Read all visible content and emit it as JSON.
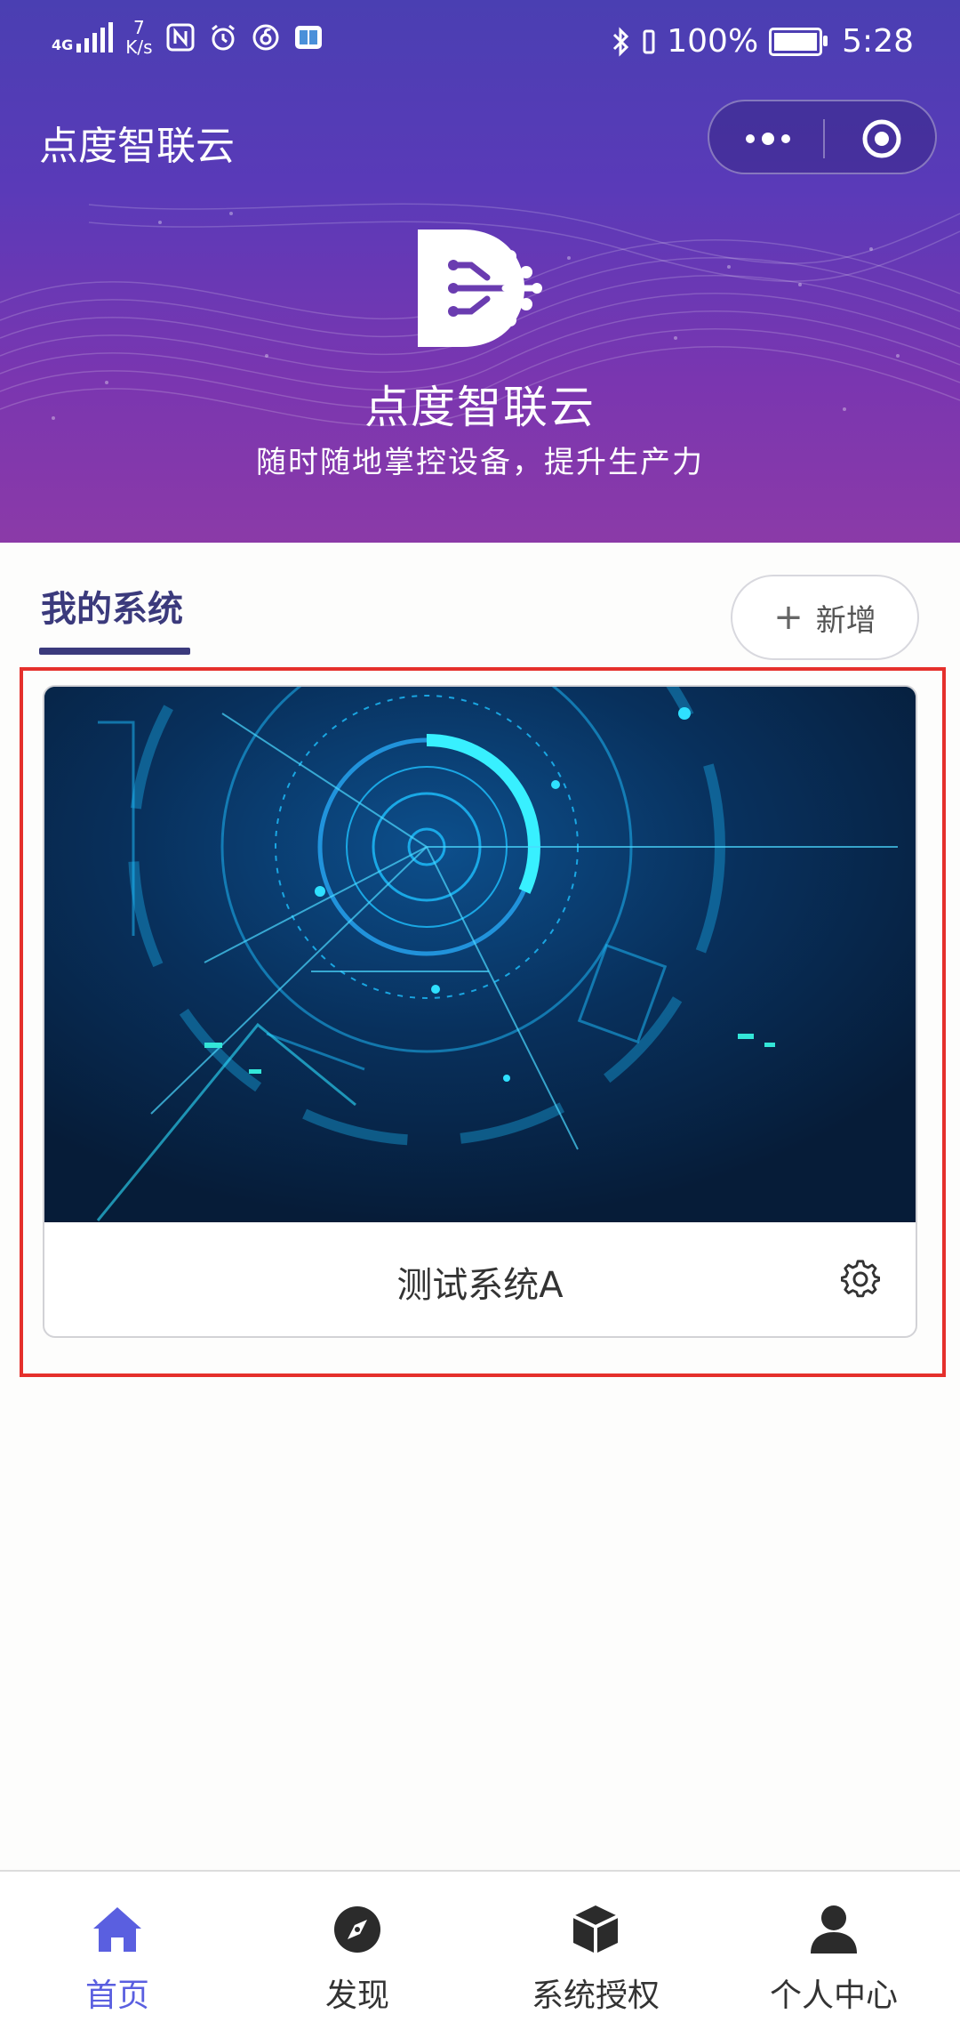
{
  "status_bar": {
    "network": "4G",
    "speed_value": "7",
    "speed_unit": "K/s",
    "battery": "100%",
    "time": "5:28"
  },
  "header": {
    "app_title": "点度智联云",
    "capsule_icons": [
      "more-icon",
      "target-icon"
    ]
  },
  "hero": {
    "brand": "点度智联云",
    "slogan": "随时随地掌控设备，提升生产力"
  },
  "section": {
    "title": "我的系统",
    "add_label": "新增"
  },
  "systems": [
    {
      "name": "测试系统A"
    }
  ],
  "tabbar": {
    "items": [
      {
        "label": "首页",
        "icon": "home-icon",
        "active": true
      },
      {
        "label": "发现",
        "icon": "compass-icon",
        "active": false
      },
      {
        "label": "系统授权",
        "icon": "box-icon",
        "active": false
      },
      {
        "label": "个人中心",
        "icon": "user-icon",
        "active": false
      }
    ]
  },
  "colors": {
    "header_gradient_top": "#4a3fb2",
    "header_gradient_bottom": "#8b3aa8",
    "accent": "#3b3a7c",
    "active_tab": "#5a5fe0",
    "highlight": "#e5302c"
  }
}
